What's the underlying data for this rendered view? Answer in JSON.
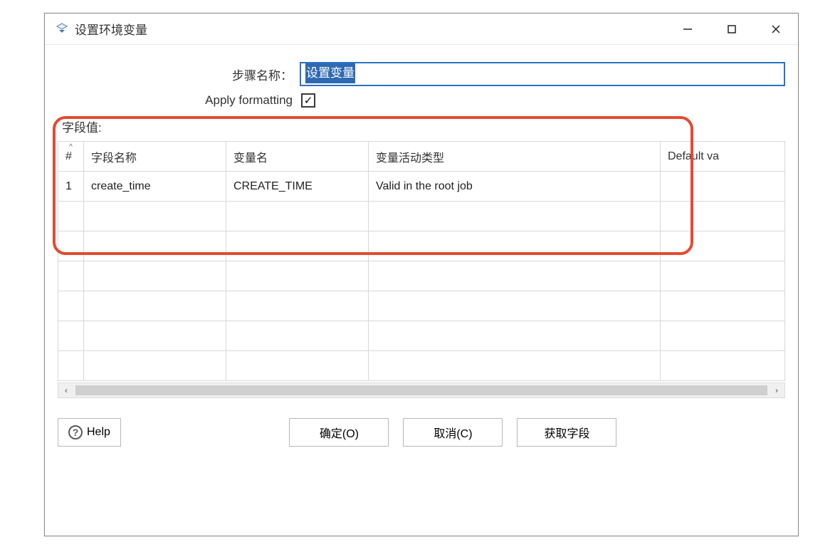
{
  "titlebar": {
    "title": "设置环境变量"
  },
  "form": {
    "step_name_label": "步骤名称：",
    "step_name_value": "设置变量",
    "apply_formatting_label": "Apply formatting",
    "apply_formatting_checked": "✓"
  },
  "section": {
    "field_values_label": "字段值:"
  },
  "table": {
    "headers": {
      "idx": "#",
      "field_name": "字段名称",
      "var_name": "变量名",
      "var_type": "变量活动类型",
      "default_value": "Default va"
    },
    "rows": [
      {
        "idx": "1",
        "field_name": "create_time",
        "var_name": "CREATE_TIME",
        "var_type": "Valid in the root job",
        "default_value": ""
      }
    ]
  },
  "buttons": {
    "help": "Help",
    "ok": "确定(O)",
    "cancel": "取消(C)",
    "get_fields": "获取字段"
  }
}
